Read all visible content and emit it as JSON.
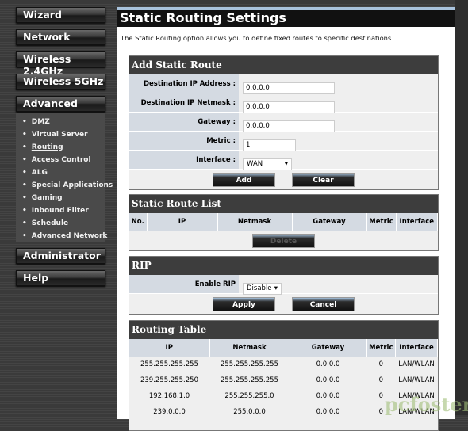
{
  "sidebar": {
    "buttons": [
      "Wizard",
      "Network",
      "Wireless 2.4GHz",
      "Wireless 5GHz",
      "Advanced",
      "Administrator",
      "Help"
    ],
    "advanced_items": [
      "DMZ",
      "Virtual Server",
      "Routing",
      "Access Control",
      "ALG",
      "Special Applications",
      "Gaming",
      "Inbound Filter",
      "Schedule",
      "Advanced Network"
    ],
    "active_item": "Routing"
  },
  "page": {
    "title": "Static Routing Settings",
    "description": "The Static Routing option allows you to define fixed routes to specific destinations."
  },
  "add_route": {
    "header": "Add Static Route",
    "fields": [
      {
        "label": "Destination IP Address :",
        "value": "0.0.0.0"
      },
      {
        "label": "Destination IP Netmask :",
        "value": "0.0.0.0"
      },
      {
        "label": "Gateway :",
        "value": "0.0.0.0"
      },
      {
        "label": "Metric :",
        "value": "1"
      }
    ],
    "interface_label": "Interface :",
    "interface_value": "WAN",
    "add": "Add",
    "clear": "Clear"
  },
  "route_list": {
    "header": "Static Route List",
    "columns": [
      "No.",
      "IP",
      "Netmask",
      "Gateway",
      "Metric",
      "Interface"
    ],
    "delete": "Delete"
  },
  "rip": {
    "header": "RIP",
    "label": "Enable RIP",
    "value": "Disable",
    "apply": "Apply",
    "cancel": "Cancel"
  },
  "routing_table": {
    "header": "Routing Table",
    "columns": [
      "IP",
      "Netmask",
      "Gateway",
      "Metric",
      "Interface"
    ],
    "rows": [
      [
        "255.255.255.255",
        "255.255.255.255",
        "0.0.0.0",
        "0",
        "LAN/WLAN"
      ],
      [
        "239.255.255.250",
        "255.255.255.255",
        "0.0.0.0",
        "0",
        "LAN/WLAN"
      ],
      [
        "192.168.1.0",
        "255.255.255.0",
        "0.0.0.0",
        "0",
        "LAN/WLAN"
      ],
      [
        "239.0.0.0",
        "255.0.0.0",
        "0.0.0.0",
        "0",
        "LAN/WLAN"
      ]
    ]
  },
  "watermark": "pcfoster"
}
